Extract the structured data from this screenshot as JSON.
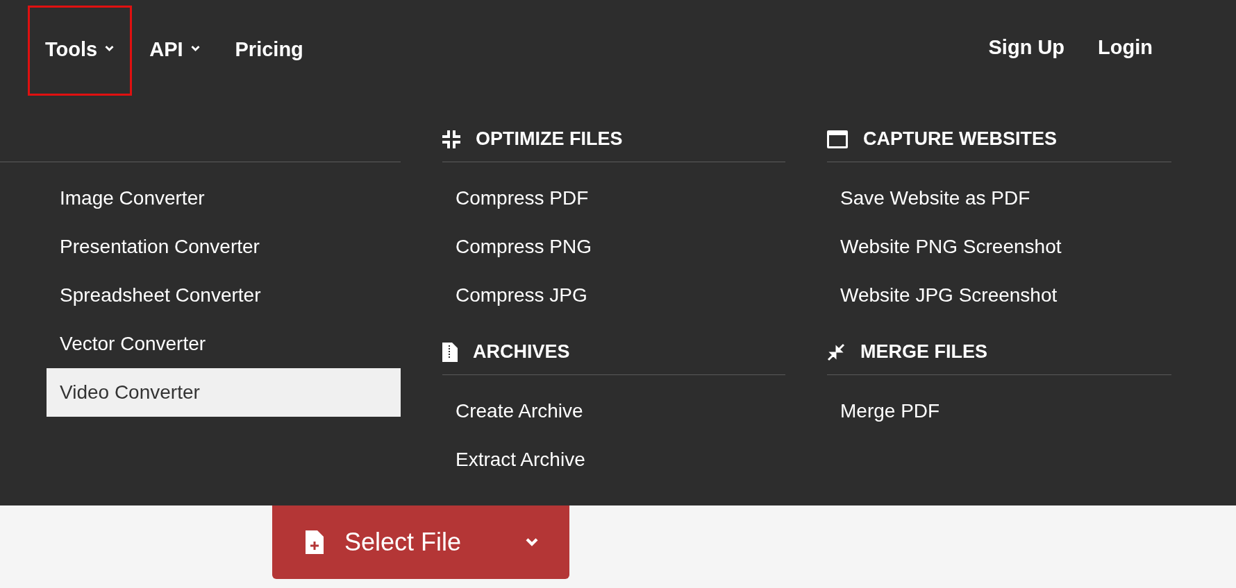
{
  "nav": {
    "left": [
      {
        "label": "Tools",
        "dropdown": true,
        "selected": true
      },
      {
        "label": "API",
        "dropdown": true,
        "selected": false
      },
      {
        "label": "Pricing",
        "dropdown": false,
        "selected": false
      }
    ],
    "right": [
      "Sign Up",
      "Login"
    ]
  },
  "menu": {
    "columns": [
      {
        "sections": [
          {
            "items": [
              {
                "label": "Image Converter",
                "selected": false
              },
              {
                "label": "Presentation Converter",
                "selected": false
              },
              {
                "label": "Spreadsheet Converter",
                "selected": false
              },
              {
                "label": "Vector Converter",
                "selected": false
              },
              {
                "label": "Video Converter",
                "selected": true
              }
            ]
          }
        ]
      },
      {
        "sections": [
          {
            "heading": "OPTIMIZE FILES",
            "kind": "compress",
            "items": [
              {
                "label": "Compress PDF",
                "selected": false
              },
              {
                "label": "Compress PNG",
                "selected": false
              },
              {
                "label": "Compress JPG",
                "selected": false
              }
            ]
          },
          {
            "heading": "ARCHIVES",
            "kind": "archive",
            "items": [
              {
                "label": "Create Archive",
                "selected": false
              },
              {
                "label": "Extract Archive",
                "selected": false
              }
            ]
          }
        ]
      },
      {
        "sections": [
          {
            "heading": "CAPTURE WEBSITES",
            "kind": "window",
            "items": [
              {
                "label": "Save Website as PDF",
                "selected": false
              },
              {
                "label": "Website PNG Screenshot",
                "selected": false
              },
              {
                "label": "Website JPG Screenshot",
                "selected": false
              }
            ]
          },
          {
            "heading": "MERGE FILES",
            "kind": "merge",
            "items": [
              {
                "label": "Merge PDF",
                "selected": false
              }
            ]
          }
        ]
      }
    ]
  },
  "select_button": {
    "label": "Select File"
  }
}
